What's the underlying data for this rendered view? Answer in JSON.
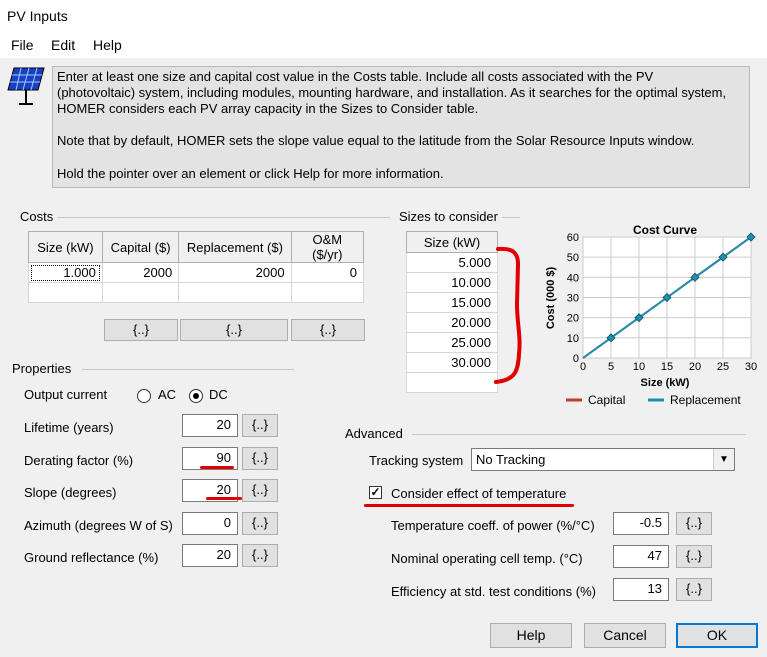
{
  "window": {
    "title": "PV Inputs"
  },
  "menu": {
    "file": "File",
    "edit": "Edit",
    "help": "Help"
  },
  "info": {
    "para1": "Enter at least one size and capital cost value in the Costs table.  Include all costs associated with the PV\n(photovoltaic) system, including modules, mounting hardware, and installation. As it searches for the optimal system,\nHOMER considers each PV array capacity in the Sizes to Consider table.",
    "para2": "Note that by default, HOMER sets the slope value equal to the latitude from the Solar Resource Inputs window.",
    "para3": "Hold the pointer over an element or click Help for more information."
  },
  "costs": {
    "label": "Costs",
    "headers": [
      "Size (kW)",
      "Capital ($)",
      "Replacement ($)",
      "O&M ($/yr)"
    ],
    "row": [
      "1.000",
      "2000",
      "2000",
      "0"
    ],
    "sens_label": "{..}"
  },
  "sizes": {
    "label": "Sizes to consider",
    "header": "Size (kW)",
    "values": [
      "5.000",
      "10.000",
      "15.000",
      "20.000",
      "25.000",
      "30.000"
    ]
  },
  "chart_data": {
    "type": "line",
    "title": "Cost Curve",
    "xlabel": "Size (kW)",
    "ylabel": "Cost (000 $)",
    "xlim": [
      0,
      30
    ],
    "ylim": [
      0,
      60
    ],
    "xticks": [
      0,
      5,
      10,
      15,
      20,
      25,
      30
    ],
    "yticks": [
      0,
      10,
      20,
      30,
      40,
      50,
      60
    ],
    "series": [
      {
        "name": "Capital",
        "color": "#c0392b",
        "x": [
          0,
          5,
          10,
          15,
          20,
          25,
          30
        ],
        "y": [
          0,
          10,
          20,
          30,
          40,
          50,
          60
        ]
      },
      {
        "name": "Replacement",
        "color": "#1f8fb0",
        "x": [
          0,
          5,
          10,
          15,
          20,
          25,
          30
        ],
        "y": [
          0,
          10,
          20,
          30,
          40,
          50,
          60
        ]
      }
    ]
  },
  "properties": {
    "label": "Properties",
    "output_current": "Output current",
    "ac": "AC",
    "dc": "DC",
    "lifetime_label": "Lifetime (years)",
    "lifetime": "20",
    "derating_label": "Derating factor (%)",
    "derating": "90",
    "slope_label": "Slope (degrees)",
    "slope": "20",
    "azimuth_label": "Azimuth (degrees W of S)",
    "azimuth": "0",
    "reflectance_label": "Ground reflectance (%)",
    "reflectance": "20"
  },
  "advanced": {
    "label": "Advanced",
    "tracking_label": "Tracking system",
    "tracking_value": "No Tracking",
    "temp_checkbox": "Consider effect of temperature",
    "temp_coeff_label": "Temperature coeff. of power (%/°C)",
    "temp_coeff": "-0.5",
    "noct_label": "Nominal operating cell temp. (°C)",
    "noct": "47",
    "eff_label": "Efficiency at std. test conditions (%)",
    "eff": "13"
  },
  "buttons": {
    "help": "Help",
    "cancel": "Cancel",
    "ok": "OK"
  },
  "colors": {
    "annotation": "#e00000"
  }
}
